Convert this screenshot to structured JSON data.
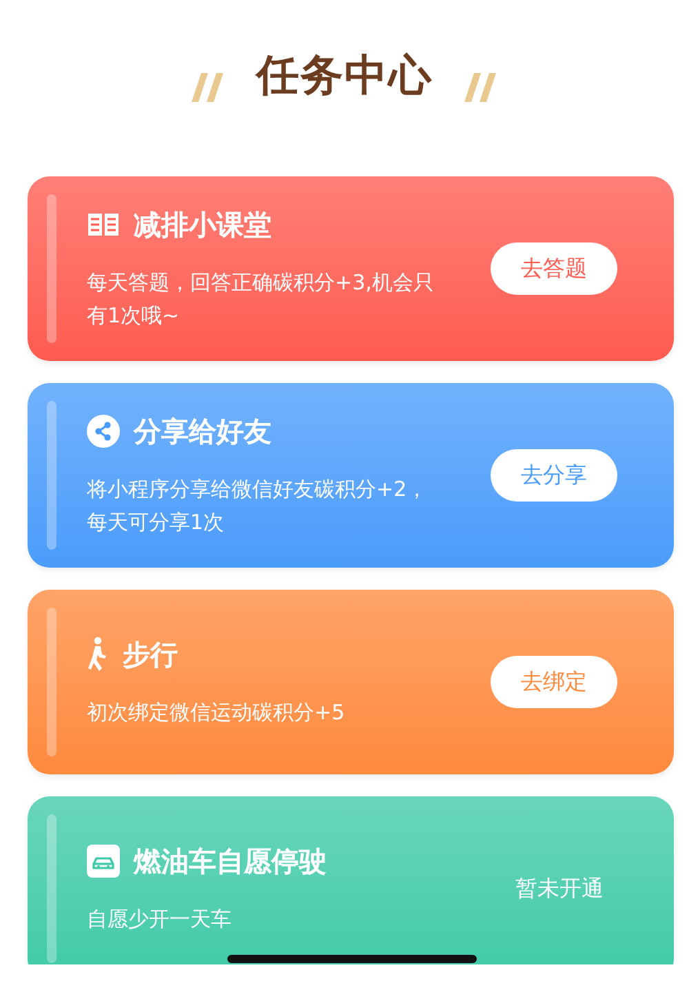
{
  "header": {
    "title": "任务中心"
  },
  "tasks": [
    {
      "title": "减排小课堂",
      "description": "每天答题，回答正确碳积分+3,机会只有1次哦~",
      "color": "#ff5b50",
      "kind": "button",
      "action": "去答题"
    },
    {
      "title": "分享给好友",
      "description": "将小程序分享给微信好友碳积分+2，每天可分享1次",
      "color": "#4a9cfb",
      "kind": "button",
      "action": "去分享"
    },
    {
      "title": "步行",
      "description": "初次绑定微信运动碳积分+5",
      "color": "#ff8a3d",
      "kind": "button",
      "action": "去绑定"
    },
    {
      "title": "燃油车自愿停驶",
      "description": "自愿少开一天车",
      "color": "#3ecaa8",
      "kind": "status",
      "action": "暂未开通"
    }
  ]
}
